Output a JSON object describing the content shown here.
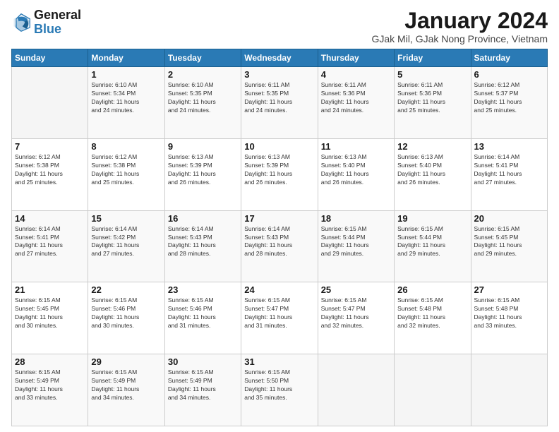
{
  "logo": {
    "general": "General",
    "blue": "Blue"
  },
  "header": {
    "title": "January 2024",
    "subtitle": "GJak Mil, GJak Nong Province, Vietnam"
  },
  "weekdays": [
    "Sunday",
    "Monday",
    "Tuesday",
    "Wednesday",
    "Thursday",
    "Friday",
    "Saturday"
  ],
  "weeks": [
    [
      {
        "day": "",
        "info": ""
      },
      {
        "day": "1",
        "info": "Sunrise: 6:10 AM\nSunset: 5:34 PM\nDaylight: 11 hours\nand 24 minutes."
      },
      {
        "day": "2",
        "info": "Sunrise: 6:10 AM\nSunset: 5:35 PM\nDaylight: 11 hours\nand 24 minutes."
      },
      {
        "day": "3",
        "info": "Sunrise: 6:11 AM\nSunset: 5:35 PM\nDaylight: 11 hours\nand 24 minutes."
      },
      {
        "day": "4",
        "info": "Sunrise: 6:11 AM\nSunset: 5:36 PM\nDaylight: 11 hours\nand 24 minutes."
      },
      {
        "day": "5",
        "info": "Sunrise: 6:11 AM\nSunset: 5:36 PM\nDaylight: 11 hours\nand 25 minutes."
      },
      {
        "day": "6",
        "info": "Sunrise: 6:12 AM\nSunset: 5:37 PM\nDaylight: 11 hours\nand 25 minutes."
      }
    ],
    [
      {
        "day": "7",
        "info": "Sunrise: 6:12 AM\nSunset: 5:38 PM\nDaylight: 11 hours\nand 25 minutes."
      },
      {
        "day": "8",
        "info": "Sunrise: 6:12 AM\nSunset: 5:38 PM\nDaylight: 11 hours\nand 25 minutes."
      },
      {
        "day": "9",
        "info": "Sunrise: 6:13 AM\nSunset: 5:39 PM\nDaylight: 11 hours\nand 26 minutes."
      },
      {
        "day": "10",
        "info": "Sunrise: 6:13 AM\nSunset: 5:39 PM\nDaylight: 11 hours\nand 26 minutes."
      },
      {
        "day": "11",
        "info": "Sunrise: 6:13 AM\nSunset: 5:40 PM\nDaylight: 11 hours\nand 26 minutes."
      },
      {
        "day": "12",
        "info": "Sunrise: 6:13 AM\nSunset: 5:40 PM\nDaylight: 11 hours\nand 26 minutes."
      },
      {
        "day": "13",
        "info": "Sunrise: 6:14 AM\nSunset: 5:41 PM\nDaylight: 11 hours\nand 27 minutes."
      }
    ],
    [
      {
        "day": "14",
        "info": "Sunrise: 6:14 AM\nSunset: 5:41 PM\nDaylight: 11 hours\nand 27 minutes."
      },
      {
        "day": "15",
        "info": "Sunrise: 6:14 AM\nSunset: 5:42 PM\nDaylight: 11 hours\nand 27 minutes."
      },
      {
        "day": "16",
        "info": "Sunrise: 6:14 AM\nSunset: 5:43 PM\nDaylight: 11 hours\nand 28 minutes."
      },
      {
        "day": "17",
        "info": "Sunrise: 6:14 AM\nSunset: 5:43 PM\nDaylight: 11 hours\nand 28 minutes."
      },
      {
        "day": "18",
        "info": "Sunrise: 6:15 AM\nSunset: 5:44 PM\nDaylight: 11 hours\nand 29 minutes."
      },
      {
        "day": "19",
        "info": "Sunrise: 6:15 AM\nSunset: 5:44 PM\nDaylight: 11 hours\nand 29 minutes."
      },
      {
        "day": "20",
        "info": "Sunrise: 6:15 AM\nSunset: 5:45 PM\nDaylight: 11 hours\nand 29 minutes."
      }
    ],
    [
      {
        "day": "21",
        "info": "Sunrise: 6:15 AM\nSunset: 5:45 PM\nDaylight: 11 hours\nand 30 minutes."
      },
      {
        "day": "22",
        "info": "Sunrise: 6:15 AM\nSunset: 5:46 PM\nDaylight: 11 hours\nand 30 minutes."
      },
      {
        "day": "23",
        "info": "Sunrise: 6:15 AM\nSunset: 5:46 PM\nDaylight: 11 hours\nand 31 minutes."
      },
      {
        "day": "24",
        "info": "Sunrise: 6:15 AM\nSunset: 5:47 PM\nDaylight: 11 hours\nand 31 minutes."
      },
      {
        "day": "25",
        "info": "Sunrise: 6:15 AM\nSunset: 5:47 PM\nDaylight: 11 hours\nand 32 minutes."
      },
      {
        "day": "26",
        "info": "Sunrise: 6:15 AM\nSunset: 5:48 PM\nDaylight: 11 hours\nand 32 minutes."
      },
      {
        "day": "27",
        "info": "Sunrise: 6:15 AM\nSunset: 5:48 PM\nDaylight: 11 hours\nand 33 minutes."
      }
    ],
    [
      {
        "day": "28",
        "info": "Sunrise: 6:15 AM\nSunset: 5:49 PM\nDaylight: 11 hours\nand 33 minutes."
      },
      {
        "day": "29",
        "info": "Sunrise: 6:15 AM\nSunset: 5:49 PM\nDaylight: 11 hours\nand 34 minutes."
      },
      {
        "day": "30",
        "info": "Sunrise: 6:15 AM\nSunset: 5:49 PM\nDaylight: 11 hours\nand 34 minutes."
      },
      {
        "day": "31",
        "info": "Sunrise: 6:15 AM\nSunset: 5:50 PM\nDaylight: 11 hours\nand 35 minutes."
      },
      {
        "day": "",
        "info": ""
      },
      {
        "day": "",
        "info": ""
      },
      {
        "day": "",
        "info": ""
      }
    ]
  ]
}
